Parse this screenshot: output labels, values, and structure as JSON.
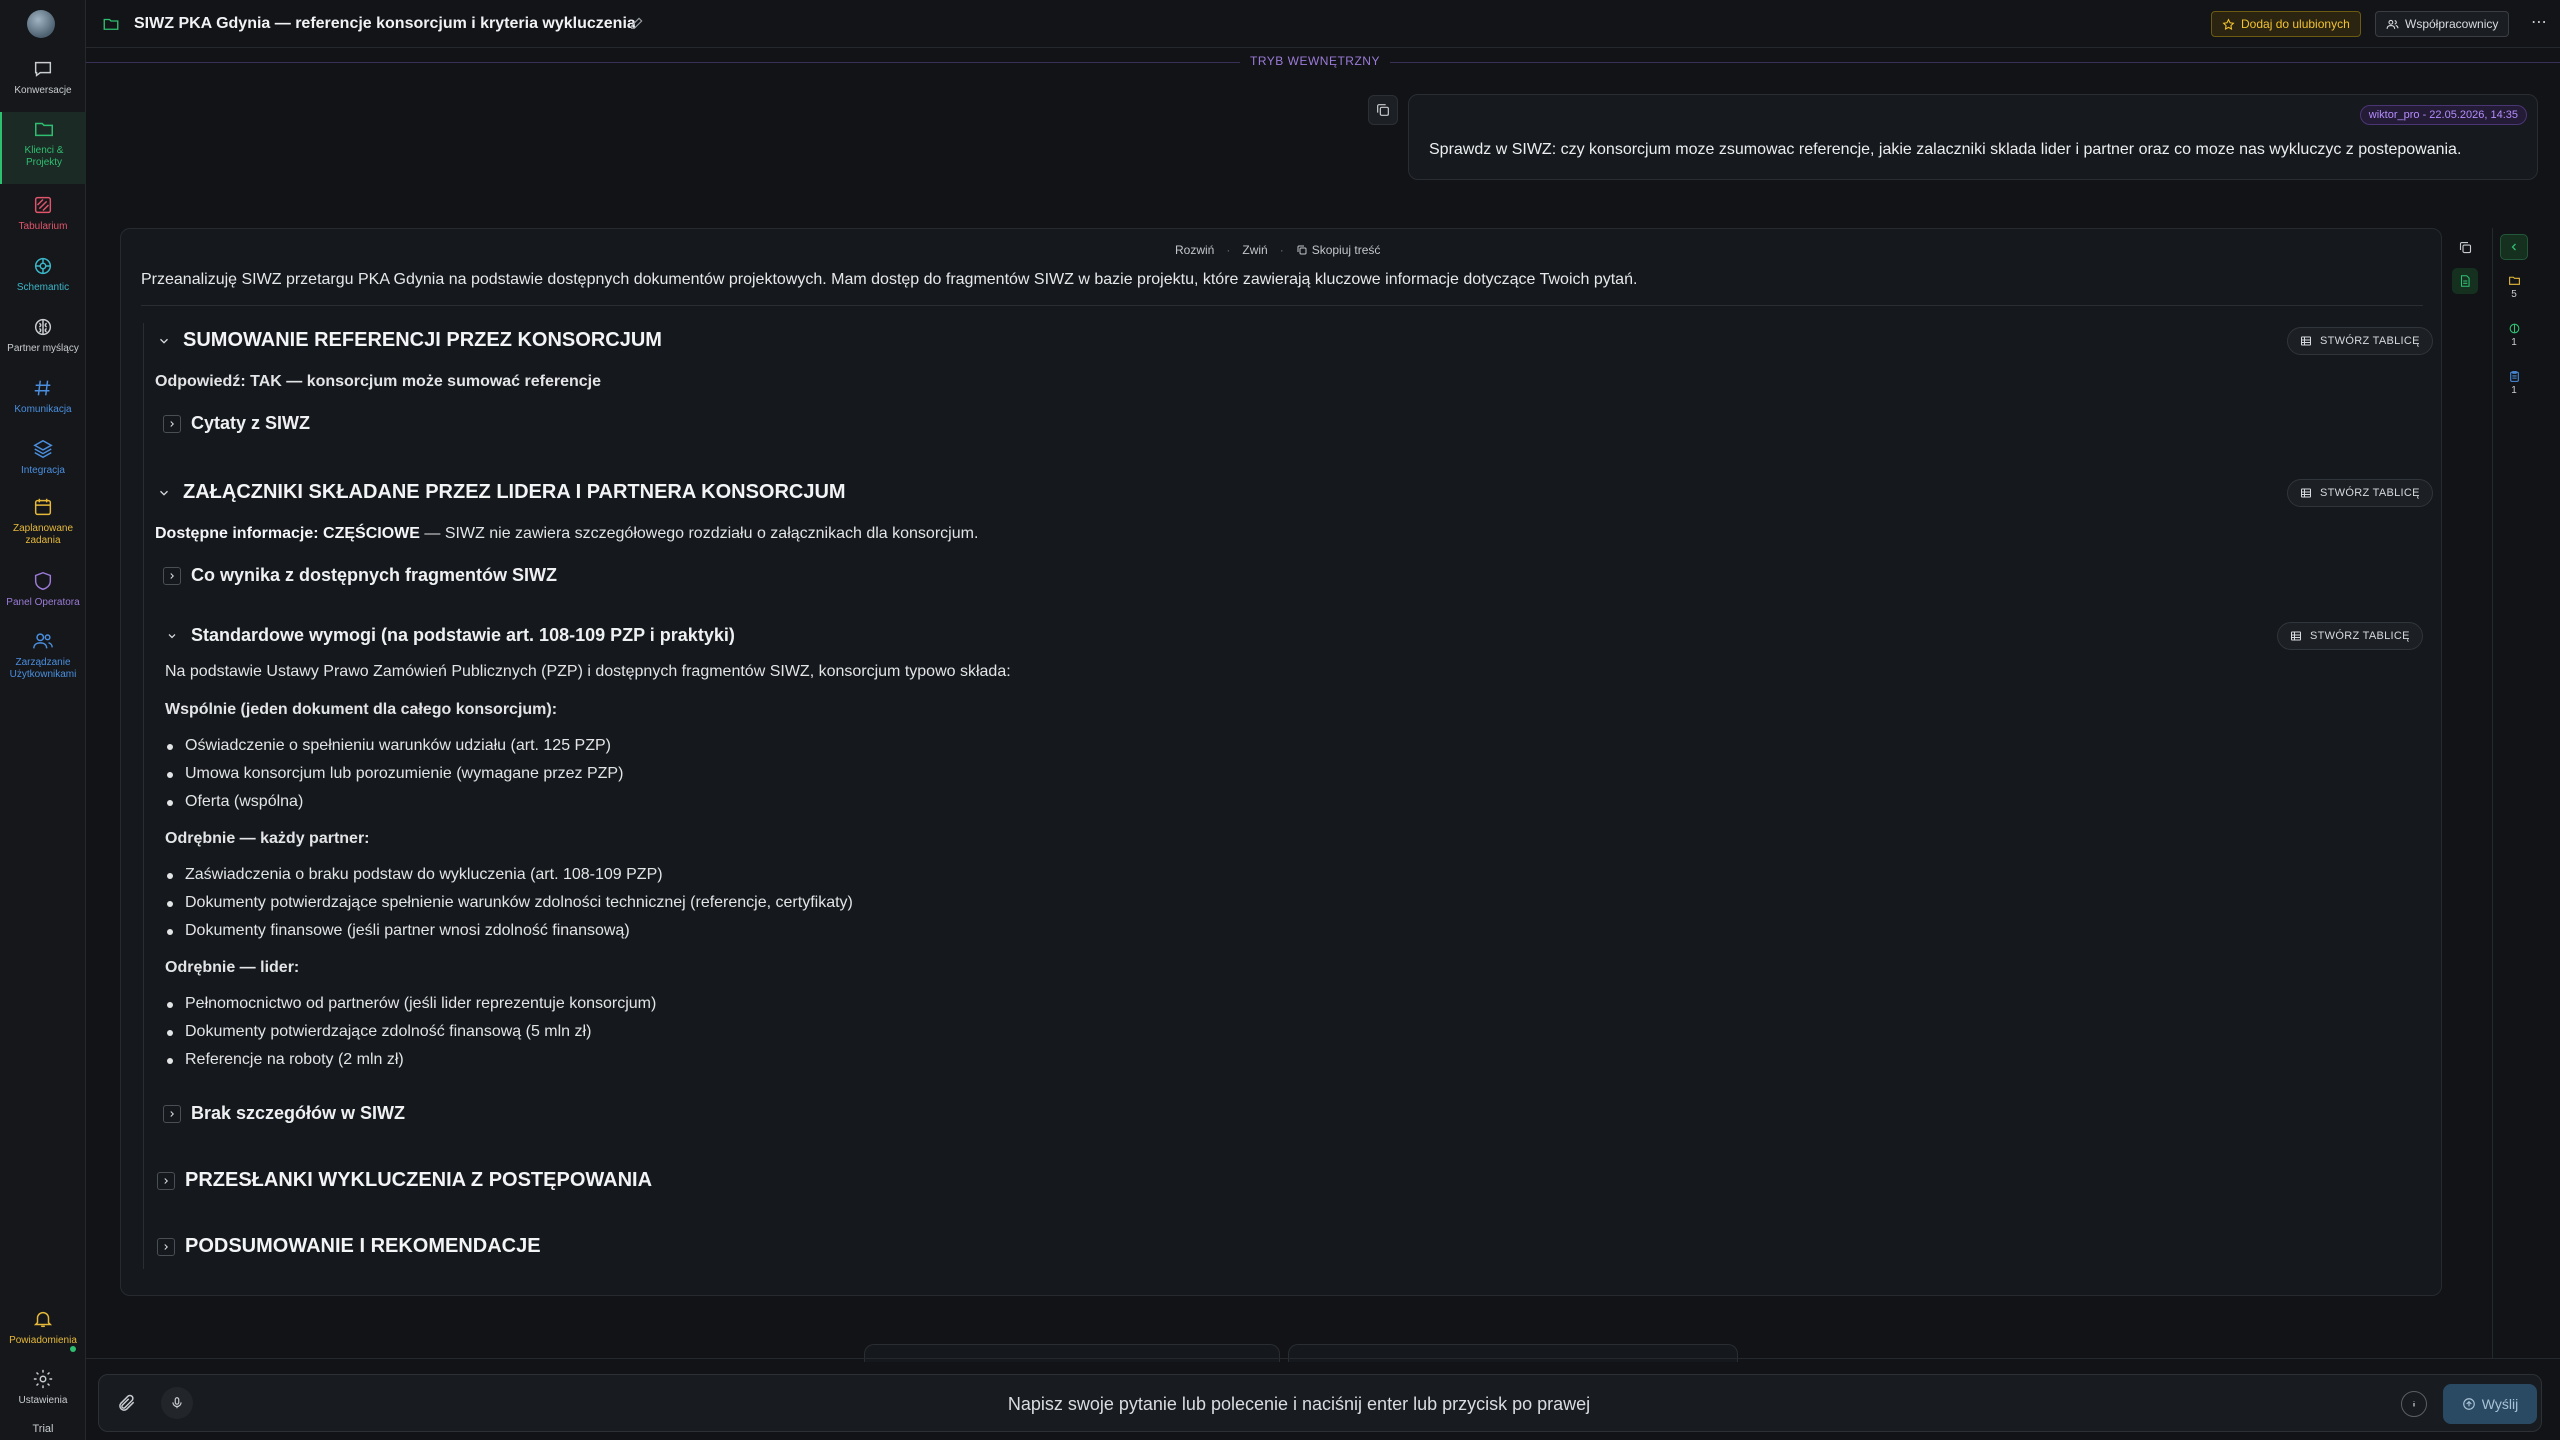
{
  "sidebar": {
    "items": [
      {
        "label": "Konwersacje",
        "icon": "chat-icon",
        "color": "#c9ccd0"
      },
      {
        "label": "Klienci & Projekty",
        "icon": "folder-icon",
        "color": "#2fbf71"
      },
      {
        "label": "Tabularium",
        "icon": "tabularium-icon",
        "color": "#e0556b"
      },
      {
        "label": "Schemantic",
        "icon": "schemantic-icon",
        "color": "#3bb6c9"
      },
      {
        "label": "Partner myślący",
        "icon": "brain-icon",
        "color": "#c9ccd0"
      },
      {
        "label": "Komunikacja",
        "icon": "hash-icon",
        "color": "#4a8fe0"
      },
      {
        "label": "Integracja",
        "icon": "layers-icon",
        "color": "#4a8fe0"
      },
      {
        "label": "Zaplanowane zadania",
        "icon": "calendar-icon",
        "color": "#e6b93a"
      },
      {
        "label": "Panel Operatora",
        "icon": "shield-icon",
        "color": "#9c7bd8"
      },
      {
        "label": "Zarządzanie Użytkownikami",
        "icon": "users-icon",
        "color": "#4a8fe0"
      }
    ],
    "notifications_label": "Powiadomienia",
    "settings_label": "Ustawienia",
    "trial_label": "Trial"
  },
  "topbar": {
    "title": "SIWZ PKA Gdynia — referencje konsorcjum i kryteria wykluczenia",
    "favorite_label": "Dodaj do ulubionych",
    "collab_label": "Współpracownicy",
    "accent_favorite": "#f2c230"
  },
  "mode_label": "TRYB WEWNĘTRZNY",
  "user_message": {
    "meta": "wiktor_pro - 22.05.2026, 14:35",
    "text": "Sprawdz w SIWZ: czy konsorcjum moze zsumowac referencje, jakie zalaczniki sklada lider i partner oraz co moze nas wykluczyc z postepowania."
  },
  "assistant": {
    "controls": {
      "expand": "Rozwiń",
      "collapse": "Zwiń",
      "copy": "Skopiuj treść"
    },
    "intro": "Przeanalizuję SIWZ przetargu PKA Gdynia na podstawie dostępnych dokumentów projektowych. Mam dostęp do fragmentów SIWZ w bazie projektu, które zawierają kluczowe informacje dotyczące Twoich pytań.",
    "table_button": "STWÓRZ TABLICĘ",
    "s1": {
      "title": "SUMOWANIE REFERENCJI PRZEZ KONSORCJUM",
      "answer": "Odpowiedź: TAK — konsorcjum może sumować referencje",
      "quotes": "Cytaty z SIWZ"
    },
    "s2": {
      "title": "ZAŁĄCZNIKI SKŁADANE PRZEZ LIDERA I PARTNERA KONSORCJUM",
      "info_bold": "Dostępne informacje: CZĘŚCIOWE",
      "info_rest": " — SIWZ nie zawiera szczegółowego rozdziału o załącznikach dla konsorcjum.",
      "sub1": "Co wynika z dostępnych fragmentów SIWZ",
      "sub2": "Standardowe wymogi (na podstawie art. 108-109 PZP i praktyki)",
      "sub2_intro": "Na podstawie Ustawy Prawo Zamówień Publicznych (PZP) i dostępnych fragmentów SIWZ, konsorcjum typowo składa:",
      "joint_title": "Wspólnie (jeden dokument dla całego konsorcjum):",
      "joint": [
        "Oświadczenie o spełnieniu warunków udziału (art. 125 PZP)",
        "Umowa konsorcjum lub porozumienie (wymagane przez PZP)",
        "Oferta (wspólna)"
      ],
      "partner_title": "Odrębnie — każdy partner:",
      "partner": [
        "Zaświadczenia o braku podstaw do wykluczenia (art. 108-109 PZP)",
        "Dokumenty potwierdzające spełnienie warunków zdolności technicznej (referencje, certyfikaty)",
        "Dokumenty finansowe (jeśli partner wnosi zdolność finansową)"
      ],
      "leader_title": "Odrębnie — lider:",
      "leader": [
        "Pełnomocnictwo od partnerów (jeśli lider reprezentuje konsorcjum)",
        "Dokumenty potwierdzające zdolność finansową (5 mln zł)",
        "Referencje na roboty (2 mln zł)"
      ],
      "sub3": "Brak szczegółów w SIWZ"
    },
    "s3_title": "PRZESŁANKI WYKLUCZENIA Z POSTĘPOWANIA",
    "s4_title": "PODSUMOWANIE I REKOMENDACJE"
  },
  "rail": {
    "folders": "5",
    "brain": "1",
    "docs": "1"
  },
  "composer": {
    "placeholder": "Napisz swoje pytanie lub polecenie i naciśnij enter lub przycisk po prawej",
    "send_label": "Wyślij"
  }
}
